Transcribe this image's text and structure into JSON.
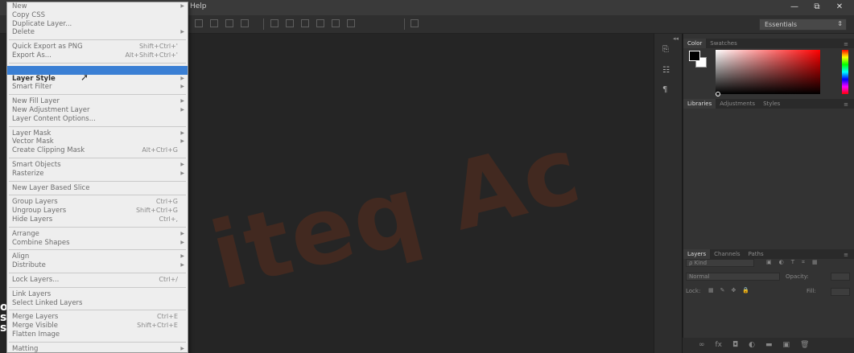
{
  "menubar": {
    "help_label": "Help"
  },
  "window_controls": {
    "minimize": "—",
    "restore": "⧉",
    "close": "✕"
  },
  "workspace": {
    "value": "Essentials",
    "caret": "⇕"
  },
  "watermark": {
    "text": "iteq Ac"
  },
  "logo": {
    "lines": [
      "o",
      "s",
      "s"
    ]
  },
  "layer_menu": {
    "groups": [
      [
        {
          "label": "New",
          "arrow": true
        },
        {
          "label": "Copy CSS"
        },
        {
          "label": "Duplicate Layer..."
        },
        {
          "label": "Delete",
          "arrow": true
        }
      ],
      [
        {
          "label": "Quick Export as PNG",
          "shortcut": "Shift+Ctrl+'"
        },
        {
          "label": "Export As...",
          "shortcut": "Alt+Shift+Ctrl+'"
        }
      ],
      [
        {
          "label": "",
          "highlighted": true
        },
        {
          "label": "Layer Style",
          "arrow": true,
          "bold": true
        },
        {
          "label": "Smart Filter",
          "arrow": true
        }
      ],
      [
        {
          "label": "New Fill Layer",
          "arrow": true
        },
        {
          "label": "New Adjustment Layer",
          "arrow": true
        },
        {
          "label": "Layer Content Options..."
        }
      ],
      [
        {
          "label": "Layer Mask",
          "arrow": true
        },
        {
          "label": "Vector Mask",
          "arrow": true
        },
        {
          "label": "Create Clipping Mask",
          "shortcut": "Alt+Ctrl+G"
        }
      ],
      [
        {
          "label": "Smart Objects",
          "arrow": true
        },
        {
          "label": "Rasterize",
          "arrow": true
        }
      ],
      [
        {
          "label": "New Layer Based Slice"
        }
      ],
      [
        {
          "label": "Group Layers",
          "shortcut": "Ctrl+G"
        },
        {
          "label": "Ungroup Layers",
          "shortcut": "Shift+Ctrl+G"
        },
        {
          "label": "Hide Layers",
          "shortcut": "Ctrl+,"
        }
      ],
      [
        {
          "label": "Arrange",
          "arrow": true
        },
        {
          "label": "Combine Shapes",
          "arrow": true
        }
      ],
      [
        {
          "label": "Align",
          "arrow": true
        },
        {
          "label": "Distribute",
          "arrow": true
        }
      ],
      [
        {
          "label": "Lock Layers...",
          "shortcut": "Ctrl+/"
        }
      ],
      [
        {
          "label": "Link Layers"
        },
        {
          "label": "Select Linked Layers"
        }
      ],
      [
        {
          "label": "Merge Layers",
          "shortcut": "Ctrl+E"
        },
        {
          "label": "Merge Visible",
          "shortcut": "Shift+Ctrl+E"
        },
        {
          "label": "Flatten Image"
        }
      ],
      [
        {
          "label": "Matting",
          "arrow": true
        }
      ]
    ]
  },
  "panels": {
    "color_tabs": [
      "Color",
      "Swatches"
    ],
    "library_tabs": [
      "Libraries",
      "Adjustments",
      "Styles"
    ],
    "layers_tabs": [
      "Layers",
      "Channels",
      "Paths"
    ],
    "kind_label": "ρ Kind",
    "blend_mode": "Normal",
    "opacity_label": "Opacity:",
    "lock_label": "Lock:",
    "fill_label": "Fill:",
    "footer_icons": [
      "∞",
      "fx",
      "◘",
      "◐",
      "▬",
      "▣",
      "🗑"
    ]
  }
}
